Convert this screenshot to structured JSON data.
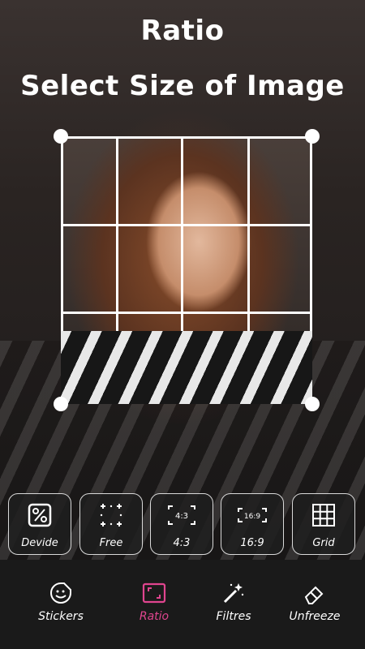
{
  "header": {
    "title": "Ratio",
    "subtitle": "Select Size of Image"
  },
  "ratio_options": [
    {
      "label": "Devide",
      "icon": "percent-icon"
    },
    {
      "label": "Free",
      "icon": "free-crop-icon"
    },
    {
      "label": "4:3",
      "icon": "ratio-4-3-icon",
      "badge": "4:3"
    },
    {
      "label": "16:9",
      "icon": "ratio-16-9-icon",
      "badge": "16:9"
    },
    {
      "label": "Grid",
      "icon": "grid-icon"
    }
  ],
  "bottom_nav": [
    {
      "label": "Stickers",
      "icon": "sticker-icon",
      "active": false
    },
    {
      "label": "Ratio",
      "icon": "ratio-icon",
      "active": true
    },
    {
      "label": "Filtres",
      "icon": "magic-wand-icon",
      "active": false
    },
    {
      "label": "Unfreeze",
      "icon": "eraser-icon",
      "active": false
    }
  ],
  "colors": {
    "accent": "#e0458f",
    "background": "#1a1a1a",
    "text": "#ffffff"
  }
}
